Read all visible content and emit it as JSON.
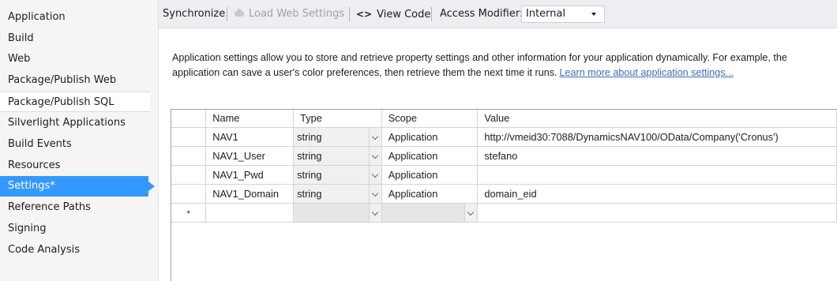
{
  "sidebar": {
    "items": [
      {
        "label": "Application"
      },
      {
        "label": "Build"
      },
      {
        "label": "Web"
      },
      {
        "label": "Package/Publish Web"
      },
      {
        "label": "Package/Publish SQL"
      },
      {
        "label": "Silverlight Applications"
      },
      {
        "label": "Build Events"
      },
      {
        "label": "Resources"
      },
      {
        "label": "Settings*",
        "selected": true
      },
      {
        "label": "Reference Paths"
      },
      {
        "label": "Signing"
      },
      {
        "label": "Code Analysis"
      }
    ]
  },
  "toolbar": {
    "synchronize_label": "Synchronize",
    "load_web_settings_label": "Load Web Settings",
    "load_web_settings_icon": "cloud-icon",
    "view_code_icon": "<>",
    "view_code_label": "View Code",
    "access_modifier_label": "Access Modifier:",
    "access_modifier_value": "Internal"
  },
  "description": {
    "text": "Application settings allow you to store and retrieve property settings and other information for your application dynamically. For example, the application can save a user's color preferences, then retrieve them the next time it runs.",
    "link_text": "Learn more about application settings..."
  },
  "grid": {
    "columns": [
      "Name",
      "Type",
      "Scope",
      "Value"
    ],
    "rows": [
      {
        "name": "NAV1",
        "type": "string",
        "scope": "Application",
        "value": "http://vmeid30:7088/DynamicsNAV100/OData/Company('Cronus')"
      },
      {
        "name": "NAV1_User",
        "type": "string",
        "scope": "Application",
        "value": "stefano"
      },
      {
        "name": "NAV1_Pwd",
        "type": "string",
        "scope": "Application",
        "value": ""
      },
      {
        "name": "NAV1_Domain",
        "type": "string",
        "scope": "Application",
        "value": "domain_eid"
      }
    ],
    "new_row_marker": "*"
  },
  "colors": {
    "selected_bg": "#3399ff",
    "toolbar_bg": "#eeeef2",
    "link": "#3e6db5"
  }
}
